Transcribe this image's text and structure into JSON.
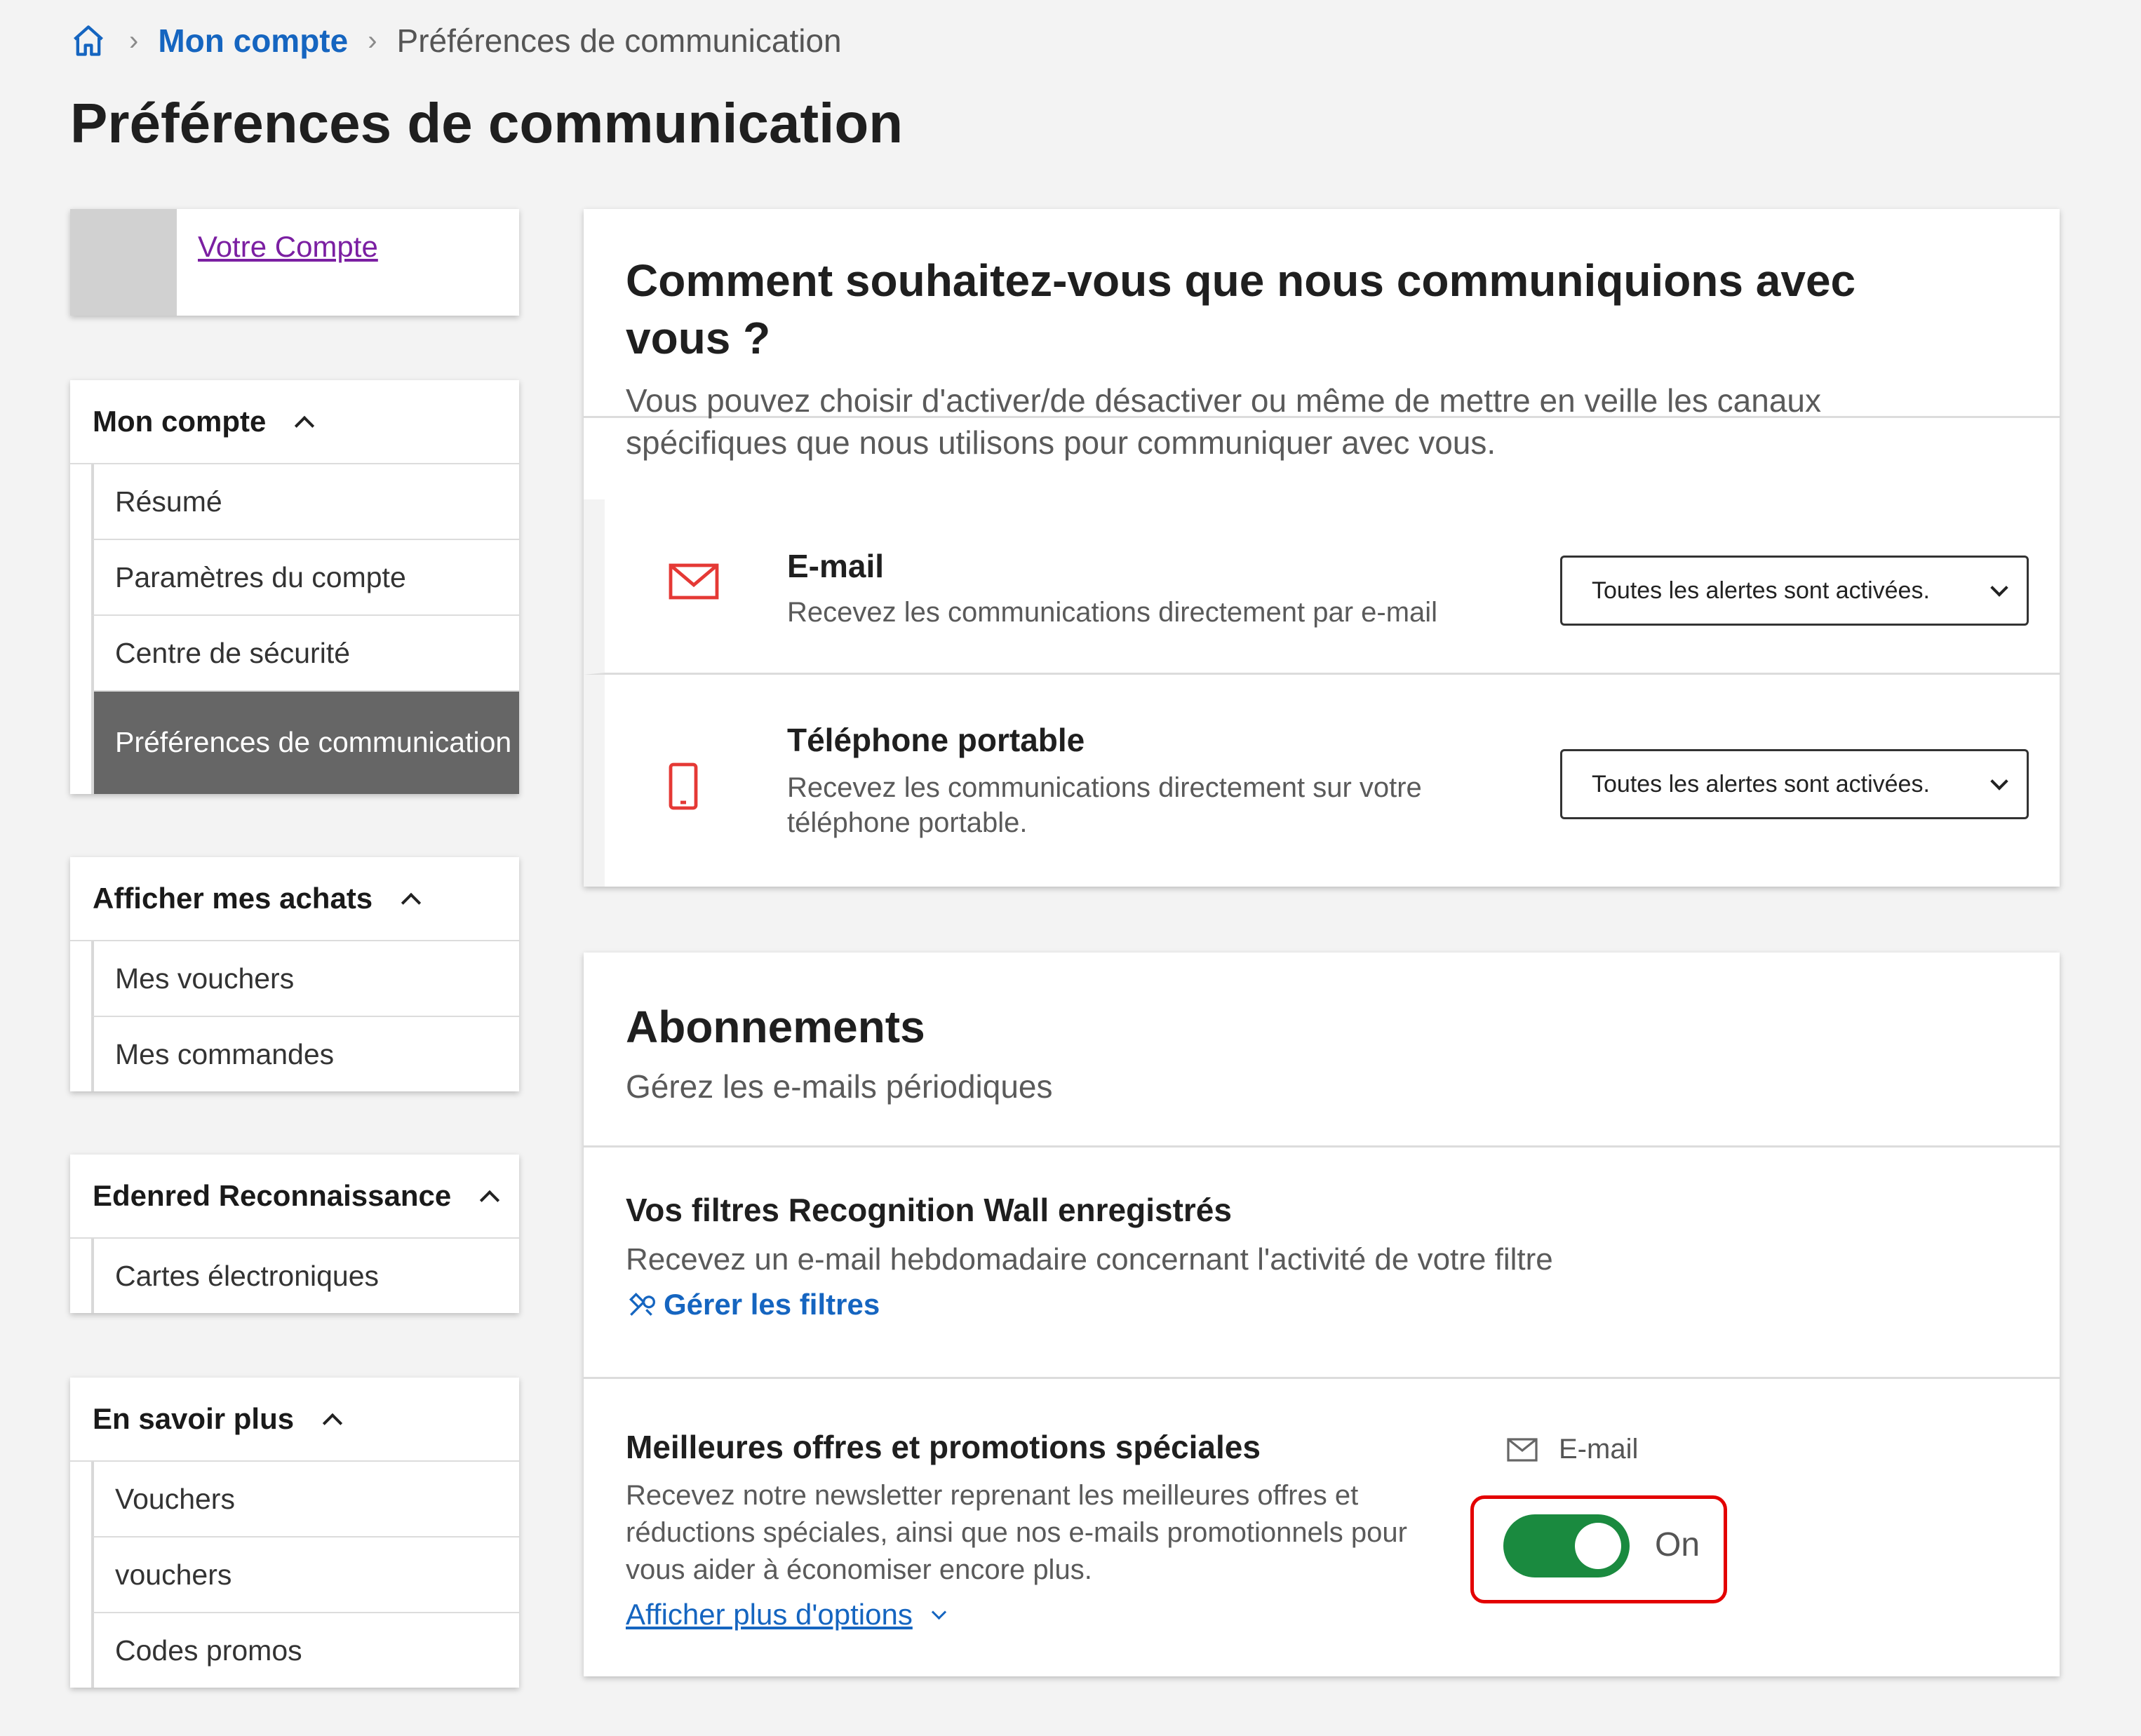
{
  "breadcrumb": {
    "home_icon": "home-icon",
    "account": "Mon compte",
    "current": "Préférences de communication"
  },
  "page_title": "Préférences de communication",
  "account_card": {
    "link": "Votre Compte"
  },
  "nav_groups": [
    {
      "title": "Mon compte",
      "items": [
        "Résumé",
        "Paramètres du compte",
        "Centre de sécurité",
        "Préférences de communication"
      ],
      "active_index": 3
    },
    {
      "title": "Afficher mes achats",
      "items": [
        "Mes vouchers",
        "Mes commandes"
      ]
    },
    {
      "title": "Edenred Reconnaissance",
      "items": [
        "Cartes électroniques"
      ]
    },
    {
      "title": "En savoir plus",
      "items": [
        "Vouchers",
        "vouchers",
        "Codes promos"
      ]
    }
  ],
  "communication": {
    "title": "Comment souhaitez-vous que nous communiquions avec vous ?",
    "subtitle": "Vous pouvez choisir d'activer/de désactiver ou même de mettre en veille les canaux spécifiques que nous utilisons pour communiquer avec vous.",
    "channels": [
      {
        "name": "E-mail",
        "description": "Recevez les communications directement par e-mail",
        "icon": "mail-icon",
        "select_value": "Toutes les alertes sont activées."
      },
      {
        "name": "Téléphone portable",
        "description": "Recevez les communications directement sur votre téléphone portable.",
        "icon": "mobile-phone-icon",
        "select_value": "Toutes les alertes sont activées."
      }
    ],
    "accent_color": "#e53935"
  },
  "subscriptions": {
    "title": "Abonnements",
    "subtitle": "Gérez les e-mails périodiques",
    "recognition": {
      "title": "Vos filtres Recognition Wall enregistrés",
      "description": "Recevez un e-mail hebdomadaire concernant l'activité de votre filtre",
      "link": "Gérer les filtres"
    },
    "offers": {
      "title": "Meilleures offres et promotions spéciales",
      "description": "Recevez notre newsletter reprenant les meilleures offres et réductions spéciales, ainsi que nos e-mails promotionnels pour vous aider à économiser encore plus.",
      "more_link": "Afficher plus d'options",
      "channel_label": "E-mail",
      "toggle_state": "On",
      "toggle_color": "#1a8a3f",
      "highlight_color": "#e30000"
    }
  }
}
